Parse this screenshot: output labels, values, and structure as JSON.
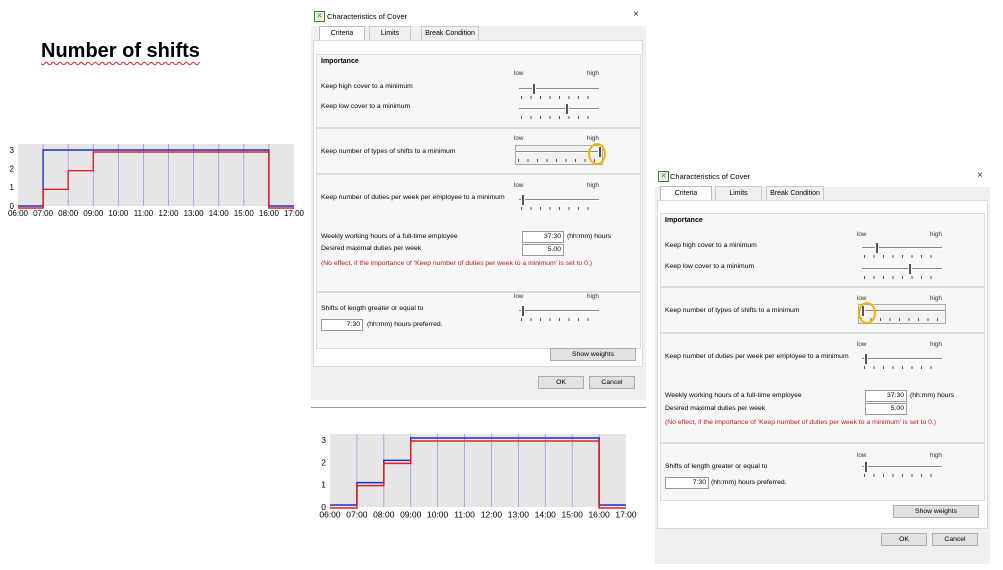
{
  "slide": {
    "title": "Number of shifts"
  },
  "dialog": {
    "title": "Characteristics of Cover",
    "tabs": [
      "Criteria",
      "Limits",
      "Break Condition"
    ],
    "importance_heading": "Importance",
    "low_label": "low",
    "high_label": "high",
    "criteria": {
      "keep_high_cover": "Keep high cover to a minimum",
      "keep_low_cover": "Keep low cover to a minimum",
      "keep_types": "Keep number of types of shifts to a minimum",
      "keep_duties": "Keep number of duties per week per employee to a minimum"
    },
    "weekly_hours_label": "Weekly working hours of a full-time employee",
    "weekly_hours_value": "37:30",
    "weekly_hours_unit": "(hh:mm) hours",
    "desired_duties_label": "Desired maximal duties per week",
    "desired_duties_value": "5.00",
    "no_effect_note": "(No effect, if the importance of 'Keep number of duties per week to a minimum' is set to 0.)",
    "shift_length_label": "Shifts of length greater or equal to",
    "shift_length_value": "7:30",
    "shift_length_unit": "(hh:mm) hours preferred.",
    "show_weights": "Show weights",
    "ok": "OK",
    "cancel": "Cancel"
  },
  "dialog_a_slider_levels": {
    "keep_high_cover": 0.15,
    "keep_low_cover": 0.6,
    "keep_types": 1.0,
    "keep_duties": 0.0,
    "shift_length": 0.0
  },
  "dialog_b_slider_levels": {
    "keep_high_cover": 0.15,
    "keep_low_cover": 0.6,
    "keep_types": 0.0,
    "keep_duties": 0.0,
    "shift_length": 0.0
  },
  "colors": {
    "required": "#1f2fbf",
    "actual": "#e02020",
    "highlight": "#f2b400",
    "plot_bg": "#e6e6e6",
    "gridline": "#b48ae0"
  },
  "chart_data": [
    {
      "type": "line",
      "step": true,
      "x": [
        "06:00",
        "07:00",
        "08:00",
        "09:00",
        "10:00",
        "11:00",
        "12:00",
        "13:00",
        "14:00",
        "15:00",
        "16:00",
        "17:00"
      ],
      "yticks": [
        0,
        1,
        2,
        3
      ],
      "ylim": [
        0,
        3
      ],
      "series": [
        {
          "values": [
            0,
            3,
            3,
            3,
            3,
            3,
            3,
            3,
            3,
            3,
            0
          ]
        },
        {
          "values": [
            0,
            1,
            2,
            3,
            3,
            3,
            3,
            3,
            3,
            3,
            0
          ]
        }
      ]
    },
    {
      "type": "line",
      "step": true,
      "x": [
        "06:00",
        "07:00",
        "08:00",
        "09:00",
        "10:00",
        "11:00",
        "12:00",
        "13:00",
        "14:00",
        "15:00",
        "16:00",
        "17:00"
      ],
      "yticks": [
        0,
        1,
        2,
        3
      ],
      "ylim": [
        0,
        3
      ],
      "series": [
        {
          "values": [
            0,
            1,
            2,
            3,
            3,
            3,
            3,
            3,
            3,
            3,
            0
          ]
        },
        {
          "values": [
            0,
            1,
            2,
            3,
            3,
            3,
            3,
            3,
            3,
            3,
            0
          ]
        }
      ]
    }
  ]
}
